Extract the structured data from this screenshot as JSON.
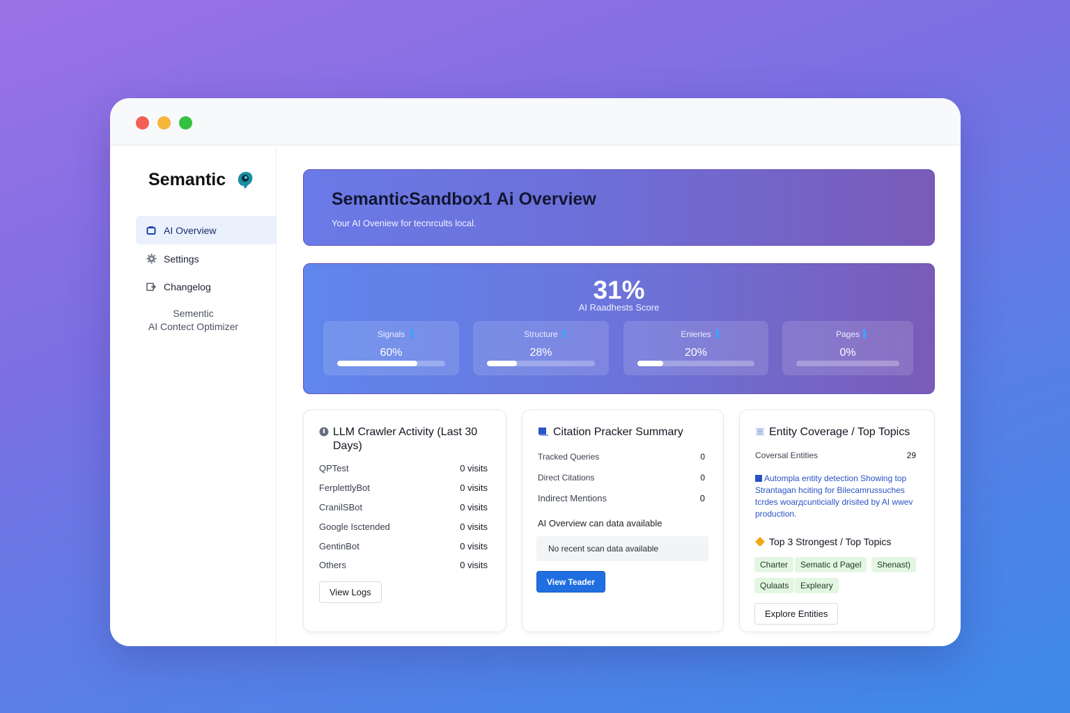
{
  "window": {
    "controls": [
      "close",
      "minimize",
      "zoom"
    ]
  },
  "sidebar": {
    "brand": "Semantic",
    "items": [
      {
        "label": "AI Overview",
        "icon": "overview-icon",
        "active": true
      },
      {
        "label": "Settings",
        "icon": "gear-icon",
        "active": false
      },
      {
        "label": "Changelog",
        "icon": "changelog-icon",
        "active": false
      }
    ],
    "footer_line1": "Sementic",
    "footer_line2": "AI Contect Optimizer"
  },
  "hero": {
    "title": "SemanticSandbox1 Ai Overview",
    "subtitle": "Your AI Oveniew for tecnrcults local."
  },
  "score": {
    "value": "31%",
    "label": "AI Raadhests Score",
    "metrics": [
      {
        "name": "Signals",
        "value": "60%",
        "fraction": 0.74
      },
      {
        "name": "Structure",
        "value": "28%",
        "fraction": 0.28
      },
      {
        "name": "Enieries",
        "value": "20%",
        "fraction": 0.22
      },
      {
        "name": "Pages",
        "value": "0%",
        "fraction": 0
      }
    ]
  },
  "crawler": {
    "title": "LLM Crawler Activity (Last 30 Days)",
    "rows": [
      {
        "bot": "QPTest",
        "visits": "0 visits"
      },
      {
        "bot": "FerplettlyBot",
        "visits": "0 visits"
      },
      {
        "bot": "CranilSBot",
        "visits": "0 visits"
      },
      {
        "bot": "Google Isctended",
        "visits": "0 visits"
      },
      {
        "bot": "GentinBot",
        "visits": "0 visits"
      },
      {
        "bot": "Others",
        "visits": "0 visits"
      }
    ],
    "button": "View Logs"
  },
  "citation": {
    "title": "Citation Pracker Summary",
    "rows": [
      {
        "label": "Tracked Queries",
        "value": "0"
      },
      {
        "label": "Direct Citations",
        "value": "0"
      },
      {
        "label": "Indirect Mentions",
        "value": "0"
      }
    ],
    "overview_label": "AI Overview can data available",
    "notice": "No recent scan data available",
    "button": "View Teader"
  },
  "entity": {
    "title": "Entity Coverage / Top Topics",
    "coverage_label": "Coversal Entities",
    "coverage_value": "29",
    "info": "Automplа entity detection Showing top Strantagan hciting for Bilecamrussuches tcrdes woarдcunticially drisited by AI wwev production.",
    "strongest_title": "Top 3 Strongest / Top Topics",
    "tags": [
      "Charter",
      "Sematic d Pagel",
      "Shenast)",
      "Qulaats",
      "Expleary"
    ],
    "button": "Explore Entities"
  },
  "colors": {
    "accent": "#1f6fe0",
    "hero_start": "#6a7ae6",
    "hero_end": "#7a5bb8",
    "tag_bg": "#e3f6e2"
  }
}
